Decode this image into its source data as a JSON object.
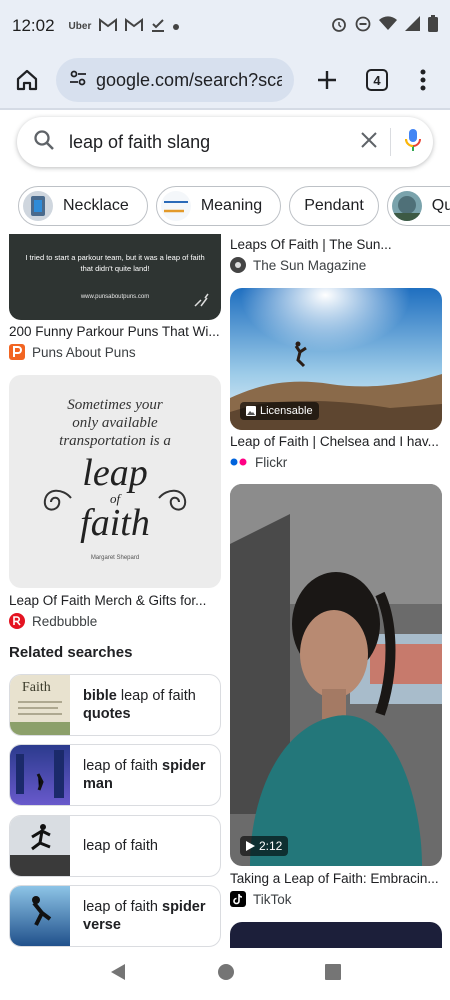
{
  "status_bar": {
    "time": "12:02",
    "left_icons": [
      "uber-icon",
      "gmail-icon",
      "gmail-icon",
      "download-done-icon",
      "dot-icon"
    ],
    "uber_label": "Uber",
    "right_icons": [
      "alarm-icon",
      "do-not-disturb-icon",
      "wifi-icon",
      "signal-icon",
      "battery-icon"
    ]
  },
  "toolbar": {
    "url": "google.com/search?sca_",
    "tab_count": "4"
  },
  "search": {
    "query": "leap of faith slang"
  },
  "chips": [
    {
      "label": "Necklace",
      "has_thumb": true
    },
    {
      "label": "Meaning",
      "has_thumb": true
    },
    {
      "label": "Pendant",
      "has_thumb": false
    },
    {
      "label": "Quote",
      "has_thumb": true
    }
  ],
  "results": {
    "parkour": {
      "image_text": "I tried to start a parkour team, but it was a leap of faith that didn't quite land!",
      "image_url_text": "www.punsaboutpuns.com",
      "title": "200 Funny Parkour Puns That Wi...",
      "source": "Puns About Puns"
    },
    "sun": {
      "title": "Leaps Of Faith | The Sun...",
      "source": "The Sun Magazine"
    },
    "flickr": {
      "badge": "Licensable",
      "title": "Leap of Faith | Chelsea and I hav...",
      "source": "Flickr"
    },
    "redbubble": {
      "image_line1": "Sometimes your",
      "image_line2": "only available",
      "image_line3": "transportation is a",
      "image_word1": "leap",
      "image_word2": "of",
      "image_word3": "faith",
      "image_author": "Margaret Shepard",
      "title": "Leap Of Faith Merch & Gifts for...",
      "source": "Redbubble"
    },
    "tiktok": {
      "duration": "2:12",
      "title": "Taking a Leap of Faith: Embracin...",
      "source": "TikTok"
    }
  },
  "related": {
    "heading": "Related searches",
    "items": [
      {
        "pre": "",
        "bold_pre": "bible",
        "mid": " leap of faith ",
        "bold_post": "quotes",
        "thumb_text": "Faith"
      },
      {
        "pre": "",
        "bold_pre": "",
        "mid": "leap of faith ",
        "bold_post": "spider man",
        "thumb_text": ""
      },
      {
        "pre": "",
        "bold_pre": "",
        "mid": "leap of faith",
        "bold_post": "",
        "thumb_text": ""
      },
      {
        "pre": "",
        "bold_pre": "",
        "mid": "leap of faith ",
        "bold_post": "spider verse",
        "thumb_text": ""
      }
    ]
  },
  "colors": {
    "chrome_bg": "#e9eef6",
    "pill_bg": "#d7e0ee",
    "mic_blue": "#4285f4",
    "mic_red": "#ea4335",
    "puns_orange": "#f26522",
    "redbubble_red": "#e41321",
    "flickr_blue": "#0063dc",
    "flickr_pink": "#ff0084"
  }
}
